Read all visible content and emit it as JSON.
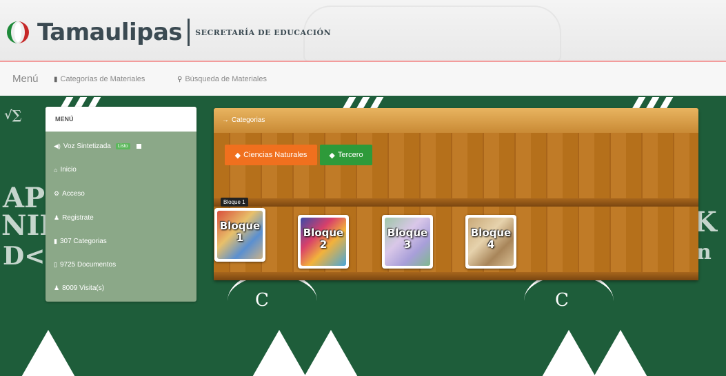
{
  "header": {
    "brand": "Tamaulipas",
    "subtitle": "SECRETARÍA DE EDUCACIÓN",
    "logo_colors": [
      "#1f8a3a",
      "#c62828"
    ]
  },
  "navbar": {
    "brand": "Menú",
    "links": [
      {
        "icon": "folder-icon",
        "label": "Categorías de Materiales"
      },
      {
        "icon": "search-icon",
        "label": "Búsqueda de Materiales"
      }
    ]
  },
  "sidebar": {
    "title": "MENÚ",
    "items": [
      {
        "icon": "audio-icon",
        "label": "Voz Sintetizada",
        "badge": "Listo"
      },
      {
        "icon": "home-icon",
        "label": "Inicio"
      },
      {
        "icon": "settings-icon",
        "label": "Acceso"
      },
      {
        "icon": "user-icon",
        "label": "Registrate"
      },
      {
        "icon": "folder-icon",
        "label": "307 Categorias"
      },
      {
        "icon": "file-icon",
        "label": "9725 Documentos"
      },
      {
        "icon": "user-icon",
        "label": "8009 Visita(s)"
      }
    ]
  },
  "shelf": {
    "title": "Categorias",
    "breadcrumb": [
      {
        "label": "Ciencias Naturales",
        "color": "#f0701e"
      },
      {
        "label": "Tercero",
        "color": "#2e9a3a"
      }
    ],
    "tooltip": "Bloque 1",
    "blocks": [
      {
        "label_line1": "Bloque",
        "label_line2": "1"
      },
      {
        "label_line1": "Bloque",
        "label_line2": "2"
      },
      {
        "label_line1": "Bloque",
        "label_line2": "3"
      },
      {
        "label_line1": "Bloque",
        "label_line2": "4"
      }
    ]
  },
  "colors": {
    "board_green": "#1e5d3a",
    "sidebar_bg": "#8ba888",
    "shelf_wood": "#b5701b",
    "accent_red": "#f39c9c"
  }
}
